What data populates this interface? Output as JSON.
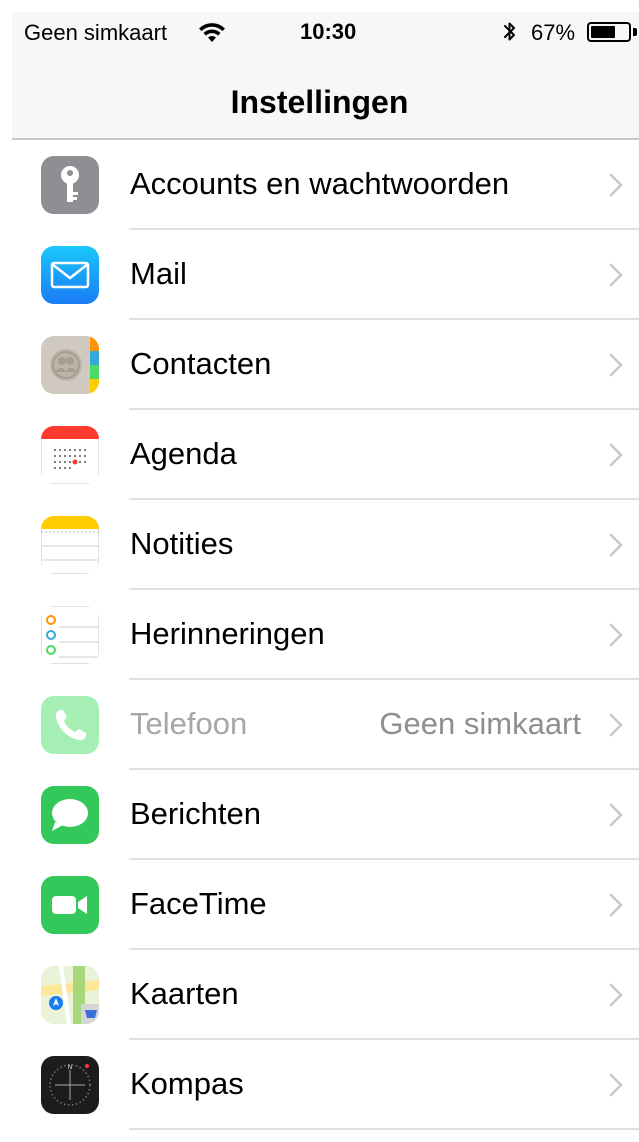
{
  "status_bar": {
    "carrier": "Geen simkaart",
    "time": "10:30",
    "battery_percent": "67%",
    "battery_level": 0.67,
    "icons": [
      "wifi-icon",
      "bluetooth-icon",
      "battery-icon"
    ]
  },
  "nav": {
    "title": "Instellingen"
  },
  "settings": [
    {
      "label": "Accounts en wachtwoorden",
      "icon": "key-icon",
      "color": "#8e8e93"
    },
    {
      "label": "Mail",
      "icon": "mail-envelope-icon",
      "color": "#1e90ff"
    },
    {
      "label": "Contacten",
      "icon": "contacts-icon",
      "color": "#c9c4bc"
    },
    {
      "label": "Agenda",
      "icon": "calendar-icon",
      "color": "#ff3b30"
    },
    {
      "label": "Notities",
      "icon": "notes-icon",
      "color": "#ffcc00"
    },
    {
      "label": "Herinneringen",
      "icon": "reminders-icon",
      "color": "#ffffff"
    },
    {
      "label": "Telefoon",
      "icon": "phone-icon",
      "color": "#4cd964",
      "detail": "Geen simkaart",
      "disabled": true
    },
    {
      "label": "Berichten",
      "icon": "messages-icon",
      "color": "#34c759"
    },
    {
      "label": "FaceTime",
      "icon": "facetime-icon",
      "color": "#34c759"
    },
    {
      "label": "Kaarten",
      "icon": "maps-icon",
      "color": "#a8d77a"
    },
    {
      "label": "Kompas",
      "icon": "compass-icon",
      "color": "#1c1c1e"
    }
  ]
}
